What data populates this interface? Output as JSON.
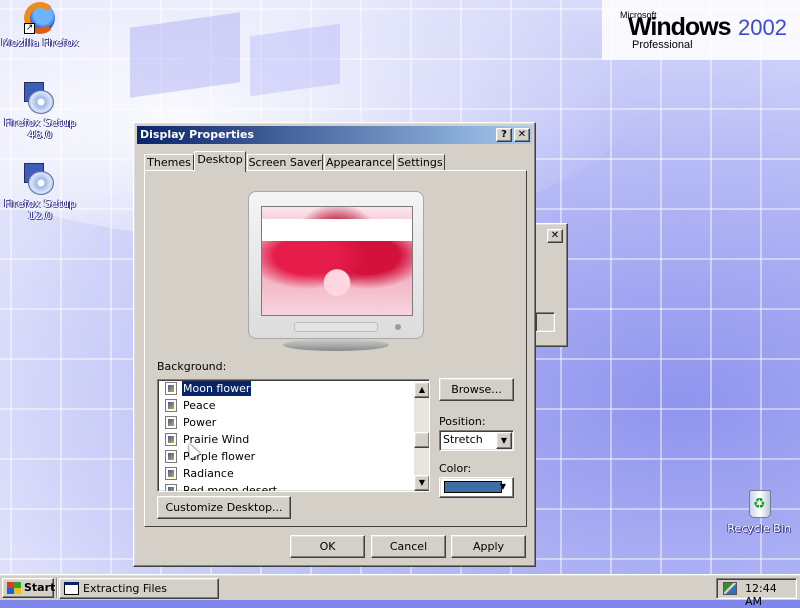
{
  "desktop": {
    "brand": {
      "microsoft": "Microsoft",
      "windows": "Windows",
      "year": "2002",
      "edition": "Professional"
    },
    "icons": [
      {
        "label": "Mozilla Firefox",
        "icon": "firefox-icon"
      },
      {
        "label": "Firefox Setup 48.0",
        "icon": "installer-disc-icon"
      },
      {
        "label": "Firefox Setup 12.0",
        "icon": "installer-disc-icon"
      },
      {
        "label": "Recycle Bin",
        "icon": "recycle-bin-icon"
      }
    ]
  },
  "dialog": {
    "title": "Display Properties",
    "help_glyph": "?",
    "close_glyph": "✕",
    "tabs": [
      {
        "label": "Themes"
      },
      {
        "label": "Desktop"
      },
      {
        "label": "Screen Saver"
      },
      {
        "label": "Appearance"
      },
      {
        "label": "Settings"
      }
    ],
    "active_tab": "Desktop",
    "background_label": "Background:",
    "background_items": [
      {
        "label": "Moon flower",
        "selected": true
      },
      {
        "label": "Peace",
        "selected": false
      },
      {
        "label": "Power",
        "selected": false
      },
      {
        "label": "Prairie Wind",
        "selected": false
      },
      {
        "label": "Purple flower",
        "selected": false
      },
      {
        "label": "Radiance",
        "selected": false
      },
      {
        "label": "Red moon desert",
        "selected": false
      }
    ],
    "browse_label": "Browse...",
    "position_label": "Position:",
    "position_value": "Stretch",
    "color_label": "Color:",
    "color_value": "#3a6ea5",
    "customize_label": "Customize Desktop...",
    "ok_label": "OK",
    "cancel_label": "Cancel",
    "apply_label": "Apply"
  },
  "background_window": {
    "close_glyph": "✕"
  },
  "taskbar": {
    "start_label": "Start",
    "tasks": [
      {
        "label": "Extracting Files"
      }
    ],
    "clock": "12:44 AM"
  }
}
